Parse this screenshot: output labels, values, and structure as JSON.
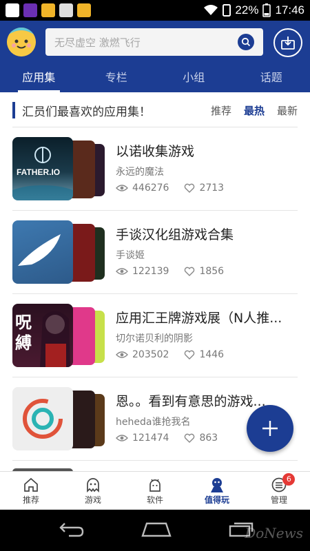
{
  "status_bar": {
    "battery_percent": "22%",
    "time": "17:46"
  },
  "header": {
    "search_placeholder": "无尽虚空 激燃飞行",
    "tabs": [
      {
        "label": "应用集",
        "active": true
      },
      {
        "label": "专栏",
        "active": false
      },
      {
        "label": "小组",
        "active": false
      },
      {
        "label": "话题",
        "active": false
      }
    ]
  },
  "section": {
    "title": "汇员们最喜欢的应用集！",
    "sort_options": [
      {
        "label": "推荐",
        "active": false
      },
      {
        "label": "最热",
        "active": true
      },
      {
        "label": "最新",
        "active": false
      }
    ]
  },
  "collections": [
    {
      "title": "以诺收集游戏",
      "author": "永远的魔法",
      "views": "446276",
      "likes": "2713",
      "cover_text": "FATHER.IO",
      "colors": [
        "#1a2b36",
        "#5a2a1c",
        "#2b1a2e"
      ]
    },
    {
      "title": "手谈汉化组游戏合集",
      "author": "手谈姬",
      "views": "122139",
      "likes": "1856",
      "cover_text": "",
      "colors": [
        "#2d5a8a",
        "#7a1a1a",
        "#1f2f1f"
      ]
    },
    {
      "title": "应用汇王牌游戏展（N人推...",
      "author": "切尔诺贝利的阴影",
      "views": "203502",
      "likes": "1446",
      "cover_text": "呪縛",
      "colors": [
        "#3a1a2a",
        "#e0398a",
        "#c7e04a"
      ]
    },
    {
      "title": "恩。。看到有意思的游戏...",
      "author": "heheda谁抢我名",
      "views": "121474",
      "likes": "863",
      "cover_text": "",
      "colors": [
        "#eeeeee",
        "#c0392b",
        "#5b3a1a"
      ]
    }
  ],
  "bottom_nav": [
    {
      "label": "推荐",
      "icon": "home-icon",
      "active": false
    },
    {
      "label": "游戏",
      "icon": "ghost-icon",
      "active": false
    },
    {
      "label": "软件",
      "icon": "android-icon",
      "active": false
    },
    {
      "label": "值得玩",
      "icon": "worth-play-icon",
      "active": true
    },
    {
      "label": "管理",
      "icon": "manage-icon",
      "active": false,
      "badge": "6"
    }
  ],
  "watermark": "DoNews",
  "colors": {
    "brand": "#1c3d93",
    "badge": "#e53935"
  }
}
